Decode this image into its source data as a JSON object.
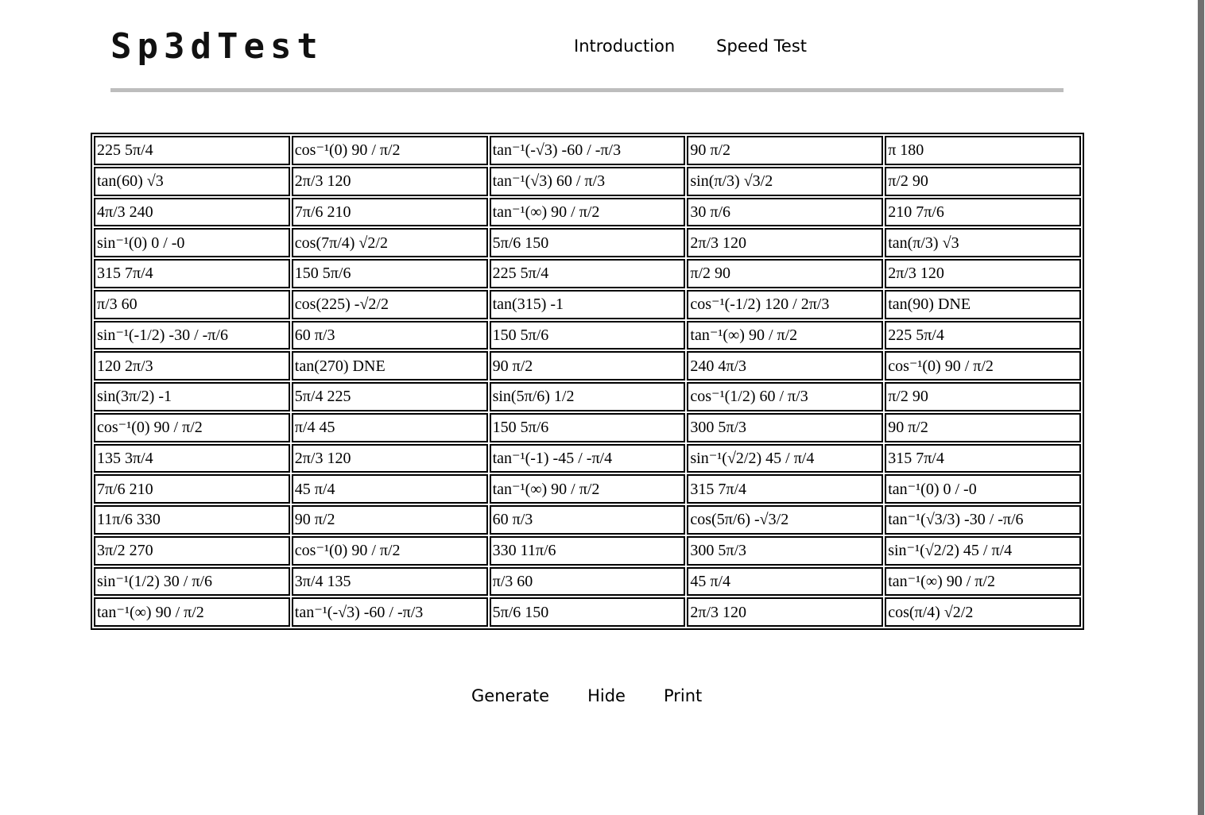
{
  "header": {
    "logo": "Sp3dTest",
    "nav": [
      "Introduction",
      "Speed Test"
    ]
  },
  "grid": {
    "rows": [
      [
        "225 5π/4",
        "cos⁻¹(0) 90 / π/2",
        "tan⁻¹(-√3) -60 / -π/3",
        "90 π/2",
        "π 180"
      ],
      [
        "tan(60) √3",
        "2π/3 120",
        "tan⁻¹(√3) 60 / π/3",
        "sin(π/3) √3/2",
        "π/2 90"
      ],
      [
        "4π/3 240",
        "7π/6 210",
        "tan⁻¹(∞) 90 / π/2",
        "30 π/6",
        "210 7π/6"
      ],
      [
        "sin⁻¹(0) 0 / -0",
        "cos(7π/4) √2/2",
        "5π/6 150",
        "2π/3 120",
        "tan(π/3) √3"
      ],
      [
        "315 7π/4",
        "150 5π/6",
        "225 5π/4",
        "π/2 90",
        "2π/3 120"
      ],
      [
        "π/3 60",
        "cos(225) -√2/2",
        "tan(315) -1",
        "cos⁻¹(-1/2) 120 / 2π/3",
        "tan(90) DNE"
      ],
      [
        "sin⁻¹(-1/2) -30 / -π/6",
        "60 π/3",
        "150 5π/6",
        "tan⁻¹(∞) 90 / π/2",
        "225 5π/4"
      ],
      [
        "120 2π/3",
        "tan(270) DNE",
        "90 π/2",
        "240 4π/3",
        "cos⁻¹(0) 90 / π/2"
      ],
      [
        "sin(3π/2) -1",
        "5π/4 225",
        "sin(5π/6) 1/2",
        "cos⁻¹(1/2) 60 / π/3",
        "π/2 90"
      ],
      [
        "cos⁻¹(0) 90 / π/2",
        "π/4 45",
        "150 5π/6",
        "300 5π/3",
        "90 π/2"
      ],
      [
        "135 3π/4",
        "2π/3 120",
        "tan⁻¹(-1) -45 / -π/4",
        "sin⁻¹(√2/2) 45 / π/4",
        "315 7π/4"
      ],
      [
        "7π/6 210",
        "45 π/4",
        "tan⁻¹(∞) 90 / π/2",
        "315 7π/4",
        "tan⁻¹(0) 0 / -0"
      ],
      [
        "11π/6 330",
        "90 π/2",
        "60 π/3",
        "cos(5π/6) -√3/2",
        "tan⁻¹(√3/3) -30 / -π/6"
      ],
      [
        "3π/2 270",
        "cos⁻¹(0) 90 / π/2",
        "330 11π/6",
        "300 5π/3",
        "sin⁻¹(√2/2) 45 / π/4"
      ],
      [
        "sin⁻¹(1/2) 30 / π/6",
        "3π/4 135",
        "π/3 60",
        "45 π/4",
        "tan⁻¹(∞) 90 / π/2"
      ],
      [
        "tan⁻¹(∞) 90 / π/2",
        "tan⁻¹(-√3) -60 / -π/3",
        "5π/6 150",
        "2π/3 120",
        "cos(π/4) √2/2"
      ]
    ]
  },
  "actions": [
    "Generate",
    "Hide",
    "Print"
  ]
}
